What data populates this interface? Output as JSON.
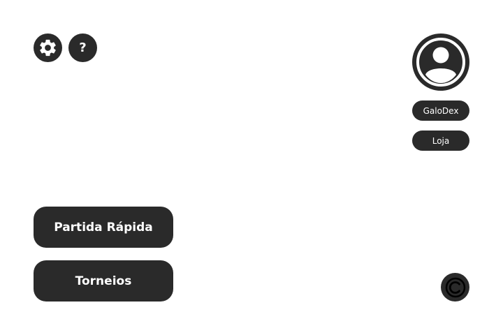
{
  "toolbar": {
    "settings_icon": "gear-icon",
    "help_label": "?"
  },
  "profile": {
    "avatar_icon": "user-avatar-icon",
    "galodex_label": "GaloDex",
    "loja_label": "Loja"
  },
  "menu": {
    "quick_match_label": "Partida Rápida",
    "tournaments_label": "Torneios"
  },
  "footer": {
    "copyright_icon": "copyright-icon"
  },
  "colors": {
    "button_bg": "#2a2a2a",
    "text_on_button": "#ffffff",
    "page_bg": "#ffffff"
  }
}
